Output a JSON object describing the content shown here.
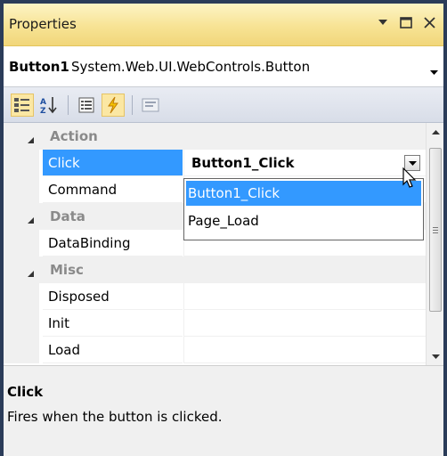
{
  "window": {
    "title": "Properties"
  },
  "selector": {
    "object_name": "Button1",
    "object_type": "System.Web.UI.WebControls.Button"
  },
  "toolbar": {
    "tools": [
      {
        "name": "categorized-icon",
        "active": true
      },
      {
        "name": "alphabetical-icon",
        "active": false
      },
      {
        "name": "properties-icon",
        "active": false
      },
      {
        "name": "events-icon",
        "active": true
      },
      {
        "name": "property-pages-icon",
        "active": false
      }
    ]
  },
  "grid": {
    "categories": {
      "action": "Action",
      "data": "Data",
      "misc": "Misc"
    },
    "rows": {
      "click": {
        "name": "Click",
        "value": "Button1_Click"
      },
      "command": {
        "name": "Command",
        "value": ""
      },
      "databinding": {
        "name": "DataBinding",
        "value": ""
      },
      "disposed": {
        "name": "Disposed",
        "value": ""
      },
      "init": {
        "name": "Init",
        "value": ""
      },
      "load": {
        "name": "Load",
        "value": ""
      }
    }
  },
  "dropdown": {
    "options": [
      "Button1_Click",
      "Page_Load"
    ],
    "selected_index": 0
  },
  "description": {
    "title": "Click",
    "text": "Fires when the button is clicked."
  },
  "colors": {
    "selection": "#3399ff",
    "titlebar": "#f7e394",
    "frame": "#2b3c59"
  }
}
